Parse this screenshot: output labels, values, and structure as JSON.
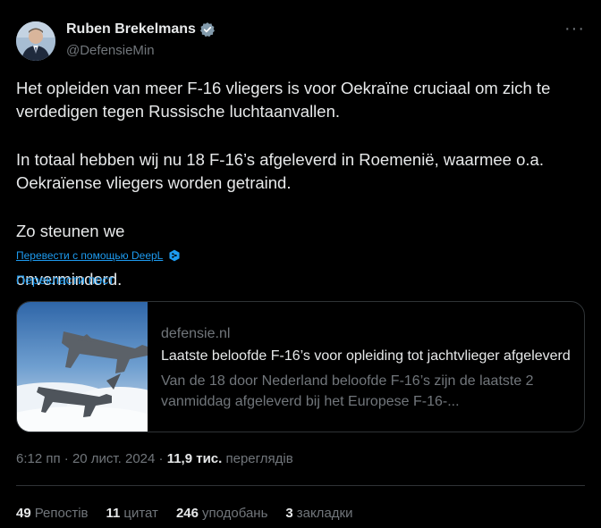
{
  "author": {
    "name": "Ruben Brekelmans",
    "handle": "@DefensieMin"
  },
  "tweet": {
    "paragraph1_line1": "Het opleiden van meer F-16 vliegers is voor Oekraïne cruciaal om zich te",
    "paragraph1_line2": "verdedigen tegen Russische luchtaanvallen.",
    "paragraph2_line1": "In totaal hebben wij nu 18 F-16’s afgeleverd in Roemenië, waarmee o.a.",
    "paragraph2_line2": "Oekraïense vliegers worden getraind.",
    "paragraph3_before": "Zo steunen we",
    "paragraph3_after": "onverminderd.",
    "flag_icon": "ukraine-flag-icon"
  },
  "translate": {
    "deepl_link": "Перевести с помощью DeepL",
    "translate_post": "Перекласти пост"
  },
  "card": {
    "domain": "defensie.nl",
    "title": "Laatste beloofde F-16’s voor opleiding tot jachtvlieger afgeleverd",
    "description": "Van de 18 door Nederland beloofde F-16’s zijn de laatste 2 vanmiddag afgeleverd bij het Europese F-16-..."
  },
  "meta": {
    "time": "6:12 пп",
    "separator": "·",
    "date": "20 лист. 2024",
    "views_count": "11,9 тис.",
    "views_label": "переглядів"
  },
  "stats": {
    "reposts_count": "49",
    "reposts_label": "Репостів",
    "quotes_count": "11",
    "quotes_label": "цитат",
    "likes_count": "246",
    "likes_label": "уподобань",
    "bookmarks_count": "3",
    "bookmarks_label": "закладки"
  },
  "colors": {
    "background": "#000000",
    "text": "#e7e9ea",
    "secondary": "#71767b",
    "link": "#1d9bf0",
    "border": "#2f3336"
  }
}
